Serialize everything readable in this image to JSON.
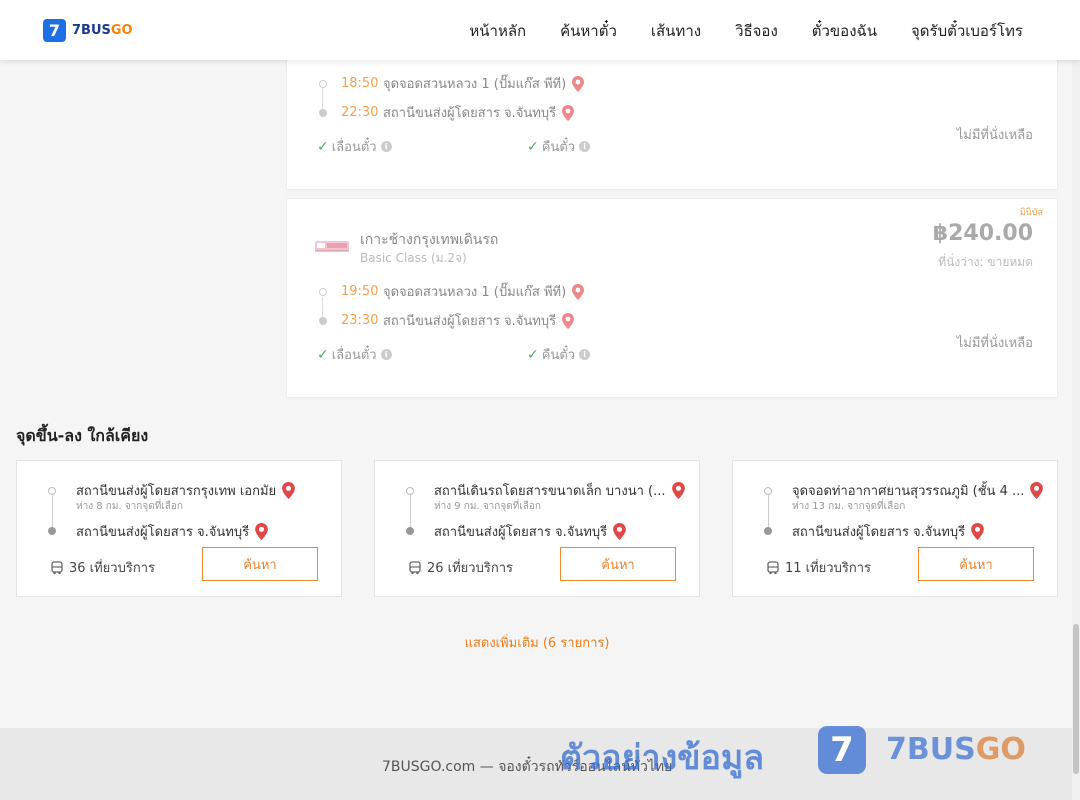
{
  "header": {
    "logo_mark": "7",
    "logo_brand_a": "7BUS",
    "logo_brand_b": "GO",
    "nav": [
      "หน้าหลัก",
      "ค้นหาตั๋ว",
      "เส้นทาง",
      "วิธีจอง",
      "ตั๋วของฉัน",
      "จุดรับตั๋วเบอร์โทร"
    ]
  },
  "trips": [
    {
      "depart_time": "18:50",
      "depart_place": "จุดจอดสวนหลวง 1 (ปั๊มแก๊ส พีที)",
      "arrive_time": "22:30",
      "arrive_place": "สถานีขนส่งผู้โดยสาร จ.จันทบุรี",
      "perk_1": "เลื่อนตั๋ว",
      "perk_2": "คืนตั๋ว",
      "availability": "ไม่มีที่นั่งเหลือ"
    },
    {
      "promo": "มินิบัส",
      "operator": "เกาะช้างกรุงเทพเดินรถ",
      "bus_class": "Basic Class (ม.2จ)",
      "price": "฿240.00",
      "seat_status": "ที่นั่งว่าง: ขายหมด",
      "depart_time": "19:50",
      "depart_place": "จุดจอดสวนหลวง 1 (ปั๊มแก๊ส พีที)",
      "arrive_time": "23:30",
      "arrive_place": "สถานีขนส่งผู้โดยสาร จ.จันทบุรี",
      "perk_1": "เลื่อนตั๋ว",
      "perk_2": "คืนตั๋ว",
      "availability": "ไม่มีที่นั่งเหลือ"
    }
  ],
  "nearby": {
    "title": "จุดขึ้น-ลง ใกล้เคียง",
    "cards": [
      {
        "from": "สถานีขนส่งผู้โดยสารกรุงเทพ เอกมัย",
        "distance": "ห่าง 8 กม. จากจุดที่เลือก",
        "to": "สถานีขนส่งผู้โดยสาร จ.จันทบุรี",
        "trips": "36 เที่ยวบริการ",
        "button": "ค้นหา"
      },
      {
        "from": "สถานีเดินรถโดยสารขนาดเล็ก บางนา (...",
        "distance": "ห่าง 9 กม. จากจุดที่เลือก",
        "to": "สถานีขนส่งผู้โดยสาร จ.จันทบุรี",
        "trips": "26 เที่ยวบริการ",
        "button": "ค้นหา"
      },
      {
        "from": "จุดจอดท่าอากาศยานสุวรรณภูมิ (ชั้น 4 ...",
        "distance": "ห่าง 13 กม. จากจุดที่เลือก",
        "to": "สถานีขนส่งผู้โดยสาร จ.จันทบุรี",
        "trips": "11 เที่ยวบริการ",
        "button": "ค้นหา"
      }
    ],
    "show_more": "แสดงเพิ่มเติม (6 รายการ)"
  },
  "footer": {
    "text": "7BUSGO.com — จองตั๋วรถทัวร์ออนไลน์ทั่วไทย"
  },
  "watermark": {
    "text": "ตัวอย่างข้อมูล",
    "logo_mark": "7",
    "brand_a": "7BUS",
    "brand_b": "GO"
  },
  "colors": {
    "brand_blue": "#1d6fe3",
    "accent_orange": "#f0802a",
    "check_green": "#4cb050",
    "pin_red": "#e04848"
  }
}
